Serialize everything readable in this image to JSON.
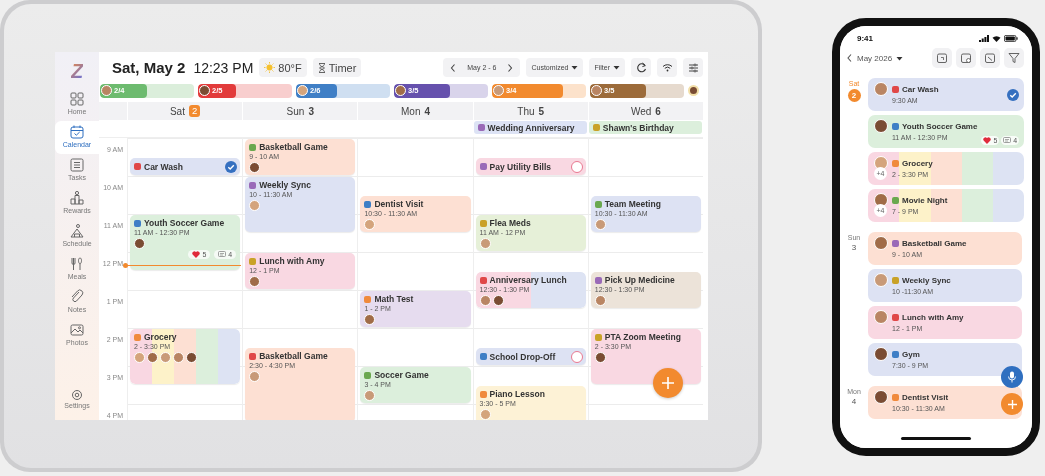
{
  "tablet": {
    "sidebar": {
      "logo": "Z",
      "items": [
        {
          "label": "Home",
          "selected": false
        },
        {
          "label": "Calendar",
          "selected": true
        },
        {
          "label": "Tasks",
          "selected": false
        },
        {
          "label": "Rewards",
          "selected": false
        },
        {
          "label": "Schedule",
          "selected": false
        },
        {
          "label": "Meals",
          "selected": false
        },
        {
          "label": "Notes",
          "selected": false
        },
        {
          "label": "Photos",
          "selected": false
        }
      ],
      "settings": "Settings"
    },
    "header": {
      "date": "Sat, May 2",
      "time": "12:23 PM",
      "weather": "80°F",
      "timer": "Timer",
      "range": "May 2 - 6",
      "view": "Customized",
      "filter": "Filter"
    },
    "members": [
      {
        "score": "2/4",
        "level": 0.5,
        "color": "#6dbb6f"
      },
      {
        "score": "2/5",
        "level": 0.4,
        "color": "#e23b3b"
      },
      {
        "score": "2/6",
        "level": 0.44,
        "color": "#3f7fc6"
      },
      {
        "score": "3/5",
        "level": 0.6,
        "color": "#6651ad"
      },
      {
        "score": "3/4",
        "level": 0.75,
        "color": "#f28a2e"
      },
      {
        "score": "3/5",
        "level": 0.6,
        "color": "#9c6b3a"
      },
      {
        "color": "#f2dfa8"
      }
    ],
    "hours": [
      "9 AM",
      "10 AM",
      "11 AM",
      "12 PM",
      "1 PM",
      "2 PM",
      "3 PM",
      "4 PM"
    ],
    "days": [
      {
        "name": "Sat",
        "date": "2",
        "selected": true,
        "events": [
          {
            "title": "Car Wash",
            "kind": "task",
            "checked": true,
            "color": "#dde2f3"
          },
          {
            "title": "Youth Soccer Game",
            "time": "11 AM - 12:30 PM",
            "color": "#dcefdc",
            "attendees": [
              {
                "kind": "avatar"
              }
            ],
            "reactions": [
              {
                "kind": "heart",
                "count": "5"
              },
              {
                "kind": "comment",
                "count": "4"
              }
            ]
          },
          {
            "title": "Grocery",
            "time": "2 - 3:30 PM",
            "stripes": [
              {
                "color": "#f9d7e2"
              },
              {
                "color": "#fdf2c9"
              },
              {
                "color": "#fde0d3"
              },
              {
                "color": "#dcefdc"
              },
              {
                "color": "#dde3f3"
              }
            ],
            "attendees": [
              {
                "kind": "avatar"
              },
              {
                "kind": "avatar"
              },
              {
                "kind": "avatar"
              },
              {
                "kind": "avatar"
              },
              {
                "kind": "avatar"
              }
            ]
          }
        ]
      },
      {
        "name": "Sun",
        "date": "3",
        "selected": false,
        "events": [
          {
            "title": "Basketball Game",
            "time": "9 - 10 AM",
            "color": "#fde0d3",
            "attendees": [
              {
                "kind": "avatar"
              }
            ]
          },
          {
            "title": "Weekly Sync",
            "time": "10 - 11:30 AM",
            "color": "#dde2f3",
            "attendees": [
              {
                "kind": "avatar"
              }
            ]
          },
          {
            "title": "Lunch with Amy",
            "time": "12 - 1 PM",
            "color": "#f9d8e2",
            "attendees": [
              {
                "kind": "avatar"
              }
            ]
          },
          {
            "title": "Basketball Game",
            "time": "2:30 - 4:30 PM",
            "color": "#fde0d3",
            "attendees": [
              {
                "kind": "avatar"
              }
            ]
          }
        ]
      },
      {
        "name": "Mon",
        "date": "4",
        "selected": false,
        "events": [
          {
            "title": "Dentist Visit",
            "time": "10:30 - 11:30 AM",
            "color": "#fde0d3",
            "attendees": [
              {
                "kind": "avatar"
              }
            ]
          },
          {
            "title": "Math Test",
            "time": "1 - 2 PM",
            "color": "#e6dcef",
            "attendees": [
              {
                "kind": "avatar"
              }
            ]
          },
          {
            "title": "Soccer Game",
            "time": "3 - 4 PM",
            "color": "#dcefdc",
            "attendees": [
              {
                "kind": "avatar"
              }
            ]
          }
        ]
      },
      {
        "name": "Thu",
        "date": "5",
        "selected": false,
        "all_day": [
          {
            "title": "Wedding Anniversary",
            "color": "#dde3f5"
          }
        ],
        "events": [
          {
            "title": "Pay Utility Bills",
            "kind": "task",
            "checked": false,
            "color": "#f9d8e2"
          },
          {
            "title": "Flea Meds",
            "time": "11 AM - 12 PM",
            "color": "#e6f0d8",
            "attendees": [
              {
                "kind": "avatar"
              }
            ]
          },
          {
            "title": "Anniversary Lunch",
            "time": "12:30 - 1:30 PM",
            "stripes": [
              {
                "color": "#f9d8e2"
              },
              {
                "color": "#dde3f3"
              }
            ],
            "attendees": [
              {
                "kind": "avatar"
              },
              {
                "kind": "avatar"
              }
            ]
          },
          {
            "title": "School Drop-Off",
            "kind": "task",
            "checked": false,
            "color": "#dde2f3"
          },
          {
            "title": "Piano Lesson",
            "time": "3:30 - 5 PM",
            "color": "#fdf2d6",
            "attendees": [
              {
                "kind": "avatar"
              }
            ]
          }
        ]
      },
      {
        "name": "Wed",
        "date": "6",
        "selected": false,
        "all_day": [
          {
            "title": "Shawn's Birthday",
            "color": "#dcefdc"
          }
        ],
        "events": [
          {
            "title": "Team Meeting",
            "time": "10:30 - 11:30 AM",
            "color": "#dde2f3",
            "attendees": [
              {
                "kind": "avatar"
              }
            ]
          },
          {
            "title": "Pick Up Medicine",
            "time": "12:30 - 1:30 PM",
            "color": "#ece3d9",
            "attendees": [
              {
                "kind": "avatar"
              }
            ]
          },
          {
            "title": "PTA Zoom Meeting",
            "time": "2 - 3:30 PM",
            "color": "#f9d8e2",
            "attendees": [
              {
                "kind": "avatar"
              }
            ]
          }
        ]
      }
    ]
  },
  "phone": {
    "status_time": "9:41",
    "month": "May 2026",
    "groups": [
      {
        "weekday": "Sat",
        "date": "2",
        "selected": true,
        "events": [
          {
            "title": "Car Wash",
            "time": "9:30 AM",
            "kind": "task",
            "checked": true,
            "color": "#dde2f3"
          },
          {
            "title": "Youth Soccer Game",
            "time": "11 AM - 12:30 PM",
            "color": "#dcefdc",
            "reactions": [
              {
                "kind": "heart",
                "count": "5"
              },
              {
                "kind": "comment",
                "count": "4"
              }
            ]
          },
          {
            "title": "Grocery",
            "time": "2 - 3:30 PM",
            "stripes": [
              {
                "color": "#f9d7e2"
              },
              {
                "color": "#fdf2c9"
              },
              {
                "color": "#fde0d3"
              },
              {
                "color": "#dcefdc"
              },
              {
                "color": "#dde3f3"
              }
            ],
            "more": "+4"
          },
          {
            "title": "Movie Night",
            "time": "7 - 9 PM",
            "stripes": [
              {
                "color": "#f9d7e2"
              },
              {
                "color": "#fdf2c9"
              },
              {
                "color": "#fde0d3"
              },
              {
                "color": "#dcefdc"
              },
              {
                "color": "#dde3f3"
              }
            ],
            "more": "+4"
          }
        ]
      },
      {
        "weekday": "Sun",
        "date": "3",
        "selected": false,
        "events": [
          {
            "title": "Basketball Game",
            "time": "9 - 10 AM",
            "color": "#fde0d3"
          },
          {
            "title": "Weekly Sync",
            "time": "10 -11:30 AM",
            "color": "#dde2f3"
          },
          {
            "title": "Lunch with Amy",
            "time": "12 - 1 PM",
            "color": "#f9d8e2"
          },
          {
            "title": "Gym",
            "time": "7:30 - 9 PM",
            "color": "#dde2f3"
          }
        ]
      },
      {
        "weekday": "Mon",
        "date": "4",
        "selected": false,
        "events": [
          {
            "title": "Dentist Visit",
            "time": "10:30 - 11:30 AM",
            "color": "#fde0d3"
          }
        ]
      }
    ]
  }
}
